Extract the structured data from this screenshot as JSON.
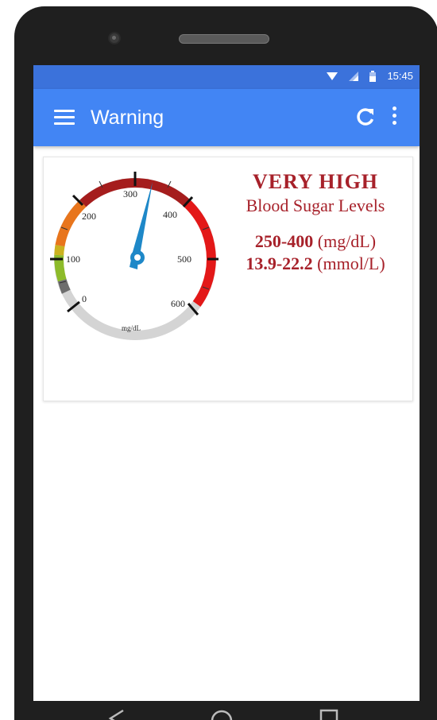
{
  "status_bar": {
    "time": "15:45"
  },
  "app_bar": {
    "title": "Warning"
  },
  "gauge": {
    "value": 300,
    "unit": "mg/dL",
    "ticks": [
      "0",
      "100",
      "200",
      "300",
      "400",
      "500",
      "600"
    ]
  },
  "reading": {
    "level": "VERY HIGH",
    "description": "Blood Sugar Levels",
    "range_mgdl_value": "250-400",
    "range_mgdl_unit": "(mg/dL)",
    "range_mmol_value": "13.9-22.2",
    "range_mmol_unit": "(mmol/L)"
  },
  "colors": {
    "primary": "#4285f4",
    "status_bar": "#3b72db",
    "alert_text": "#a7212a",
    "needle": "#1e88c8"
  }
}
